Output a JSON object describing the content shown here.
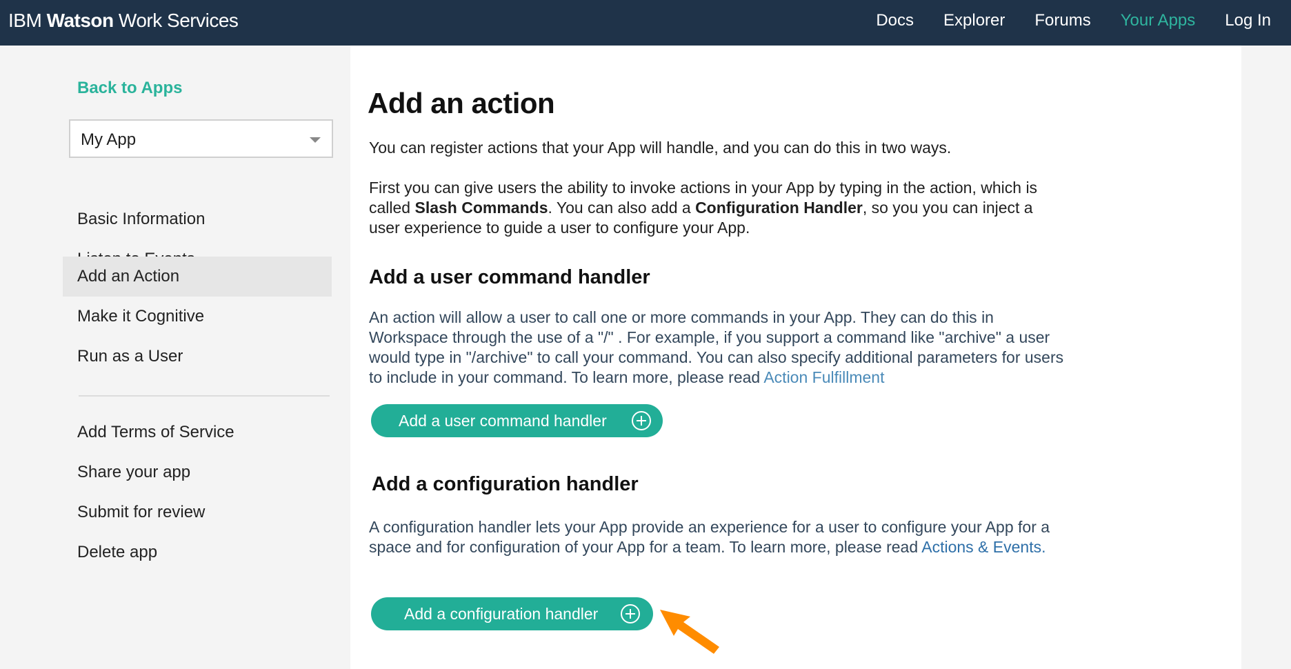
{
  "header": {
    "brand_prefix": "IBM",
    "brand_bold": "Watson",
    "brand_suffix": "Work Services",
    "nav": [
      {
        "label": "Docs"
      },
      {
        "label": "Explorer"
      },
      {
        "label": "Forums"
      },
      {
        "label": "Your Apps",
        "active": true
      },
      {
        "label": "Log In"
      }
    ],
    "accent_color": "#2fb59f",
    "background_color": "#1f3349"
  },
  "sidebar": {
    "back_label": "Back to Apps",
    "app_select_value": "My App",
    "items": [
      {
        "label": "Basic Information"
      },
      {
        "label": "Listen to Events"
      },
      {
        "label": "Add an Action",
        "active": true
      },
      {
        "label": "Make it Cognitive"
      },
      {
        "label": "Run as a User"
      }
    ],
    "secondary_items": [
      {
        "label": "Add Terms of Service"
      },
      {
        "label": "Share your app"
      },
      {
        "label": "Submit for review"
      },
      {
        "label": "Delete app"
      }
    ]
  },
  "main": {
    "title": "Add an action",
    "intro": "You can register actions that your App will handle, and you can do this in two ways.",
    "desc_part1": "First you can give users the ability to invoke actions in your App by typing in the action, which is called ",
    "desc_bold1": "Slash Commands",
    "desc_part2": ". You can also add a ",
    "desc_bold2": "Configuration Handler",
    "desc_part3": ", so you you can inject a user experience to guide a user to configure your App.",
    "user_command": {
      "heading": "Add a user command handler",
      "text": "An action will allow a user to call one or more commands in your App. They can do this in Workspace through the use of a \"/\" . For example, if you support a command like \"archive\" a user would type in \"/archive\" to call your command. You can also specify additional parameters for users to include in your command. To learn more, please read ",
      "link_label": "Action Fulfillment",
      "button_label": "Add a user command handler"
    },
    "config_handler": {
      "heading": "Add a configuration handler",
      "text": "A configuration handler lets your App provide an experience for a user to configure your App for a space and for configuration of your App for a team. To learn more, please read ",
      "link_label": "Actions & Events.",
      "button_label": "Add a configuration handler"
    },
    "button_color": "#22ae97",
    "annotation_arrow_color": "#ff8c00"
  }
}
